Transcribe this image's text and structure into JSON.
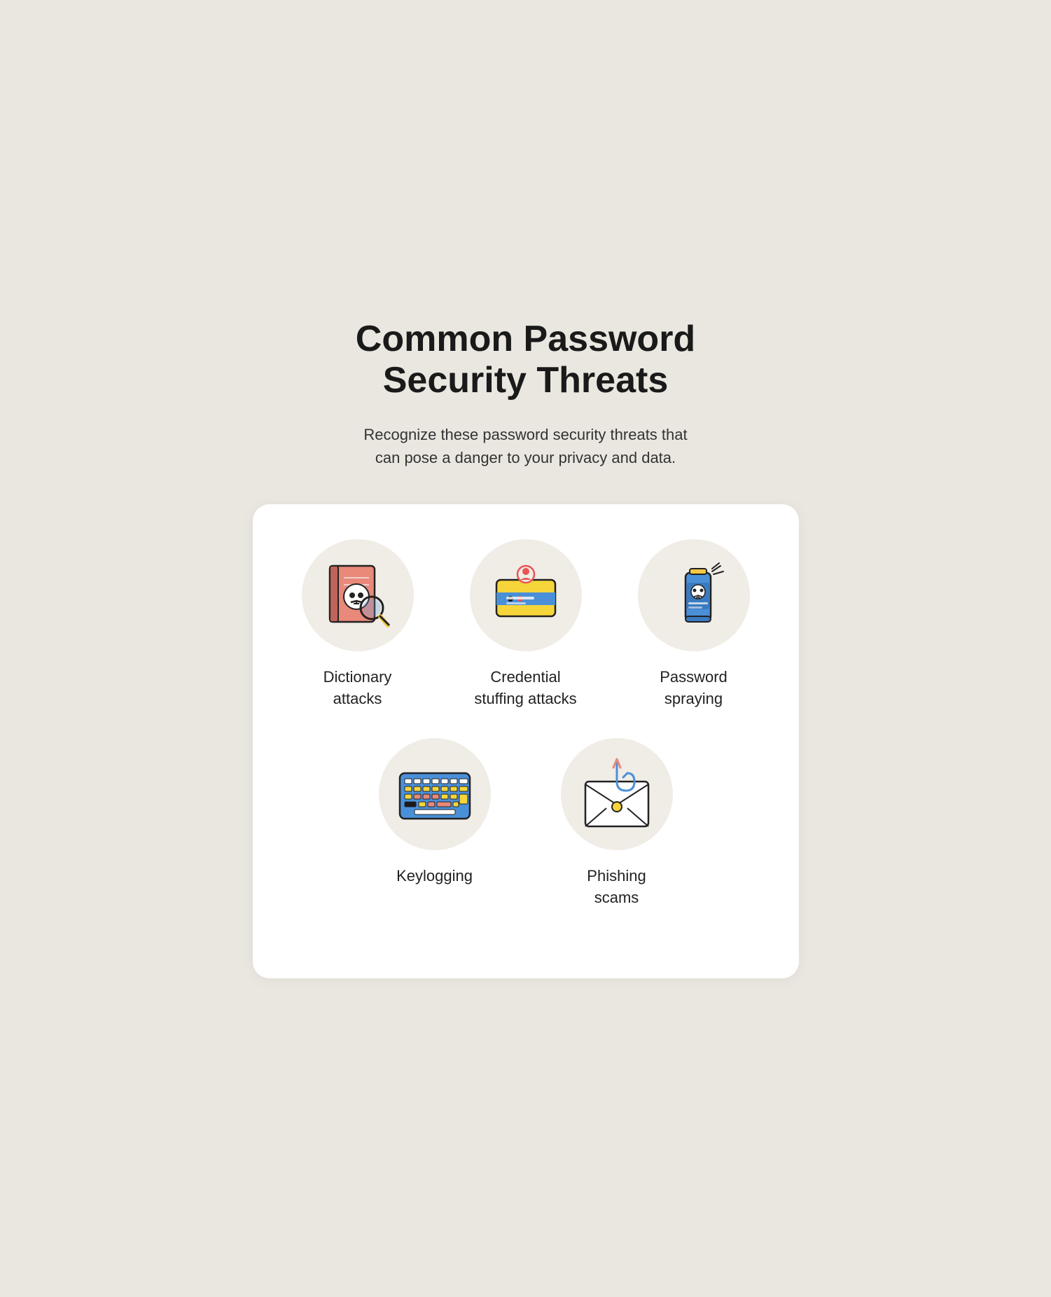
{
  "page": {
    "title": "Common Password\nSecurity Threats",
    "subtitle": "Recognize these password security threats that\ncan pose a danger to your privacy and data.",
    "card": {
      "threats": [
        {
          "id": "dictionary-attacks",
          "label": "Dictionary\nattacks"
        },
        {
          "id": "credential-stuffing",
          "label": "Credential\nstuffing attacks"
        },
        {
          "id": "password-spraying",
          "label": "Password\nspraying"
        },
        {
          "id": "keylogging",
          "label": "Keylogging"
        },
        {
          "id": "phishing-scams",
          "label": "Phishing\nscams"
        }
      ]
    }
  }
}
